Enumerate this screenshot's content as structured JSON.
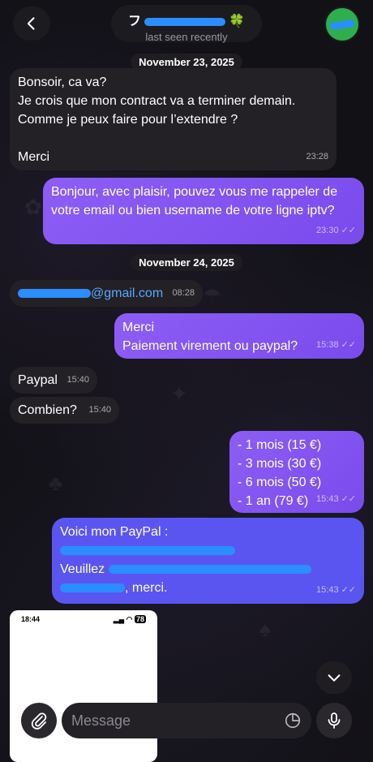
{
  "header": {
    "contact_name_start": "フ",
    "contact_status": "last seen recently"
  },
  "dates": [
    "November 23, 2025",
    "November 24, 2025"
  ],
  "messages": [
    {
      "text": "Bonsoir, ca va?\nJe crois que mon contract va a terminer demain.\nComme je peux faire pour l’extendre ?\n\nMerci",
      "time": "23:28"
    },
    {
      "text": "Bonjour, avec plaisir, pouvez vous me rappeler de votre email ou bien username de votre ligne iptv?",
      "time": "23:30"
    },
    {
      "text": "@gmail.com",
      "time": "08:28"
    },
    {
      "text": "Merci\nPaiement virement ou paypal?",
      "time": "15:38"
    },
    {
      "text": "Paypal",
      "time": "15:40"
    },
    {
      "text": "Combien?",
      "time": "15:40"
    },
    {
      "text": "- 1 mois (15 €)\n- 3 mois (30 €)\n- 6 mois (50 €)\n- 1 an (79 €)",
      "time": "15:43"
    },
    {
      "line1": "Voici mon PayPal :",
      "line3_start": "Veuillez ",
      "line4_end": ", merci.",
      "time": "15:43"
    }
  ],
  "thumbnail": {
    "time": "18:44",
    "battery": "78"
  },
  "composer": {
    "placeholder": "Message"
  },
  "icons": {
    "back": "chevron-left-icon",
    "attach": "paperclip-icon",
    "sticker": "sticker-icon",
    "mic": "microphone-icon",
    "scroll": "chevron-down-icon"
  },
  "colors": {
    "outgoing": "#8c5ef5",
    "incoming": "#232126",
    "redaction": "#2b8dff"
  }
}
